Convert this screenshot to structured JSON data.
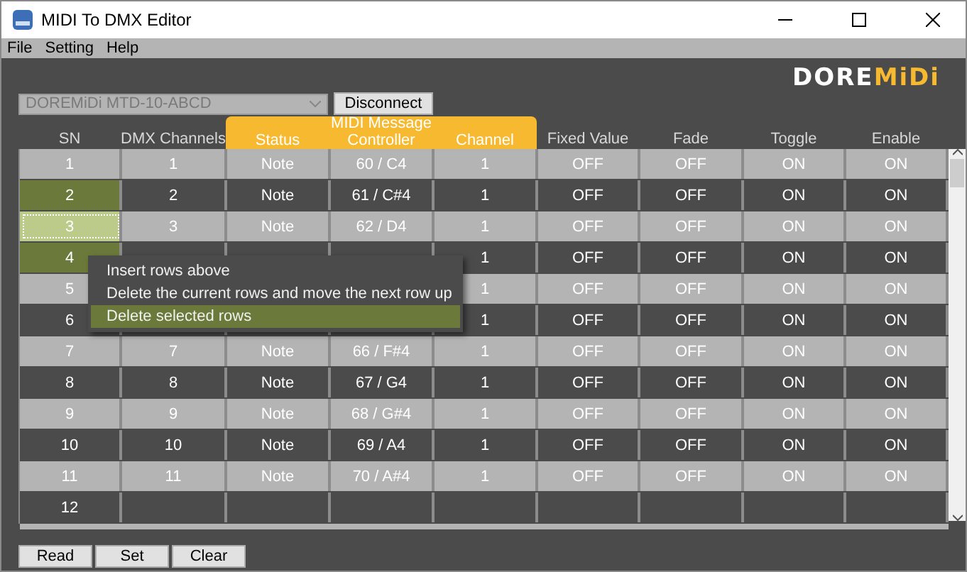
{
  "window": {
    "title": "MIDI To DMX Editor"
  },
  "menu": [
    "File",
    "Setting",
    "Help"
  ],
  "logo": [
    {
      "text": "DORE",
      "color": "#ffffff"
    },
    {
      "text": "MiDi",
      "color": "#f6b92f"
    }
  ],
  "device": {
    "value": "DOREMiDi MTD-10-ABCD",
    "disabled": true
  },
  "connect_button": "Disconnect",
  "table": {
    "column_group": "MIDI Message",
    "columns": [
      {
        "label": "SN",
        "grouped": false
      },
      {
        "label": "DMX Channels",
        "grouped": false
      },
      {
        "label": "Status",
        "grouped": true
      },
      {
        "label": "Controller",
        "grouped": true
      },
      {
        "label": "Channel",
        "grouped": true
      },
      {
        "label": "Fixed Value",
        "grouped": false
      },
      {
        "label": "Fade",
        "grouped": false
      },
      {
        "label": "Toggle",
        "grouped": false
      },
      {
        "label": "Enable",
        "grouped": false
      }
    ],
    "rows": [
      {
        "selected": false,
        "focused": false,
        "cells": [
          "1",
          "1",
          "Note",
          "60 / C4",
          "1",
          "OFF",
          "OFF",
          "ON",
          "ON"
        ]
      },
      {
        "selected": true,
        "focused": false,
        "cells": [
          "2",
          "2",
          "Note",
          "61 / C#4",
          "1",
          "OFF",
          "OFF",
          "ON",
          "ON"
        ]
      },
      {
        "selected": true,
        "focused": true,
        "cells": [
          "3",
          "3",
          "Note",
          "62 / D4",
          "1",
          "OFF",
          "OFF",
          "ON",
          "ON"
        ]
      },
      {
        "selected": true,
        "focused": false,
        "cells": [
          "4",
          null,
          null,
          null,
          "1",
          "OFF",
          "OFF",
          "ON",
          "ON"
        ]
      },
      {
        "selected": false,
        "focused": false,
        "cells": [
          "5",
          null,
          null,
          null,
          "1",
          "OFF",
          "OFF",
          "ON",
          "ON"
        ]
      },
      {
        "selected": false,
        "focused": false,
        "cells": [
          "6",
          null,
          null,
          null,
          "1",
          "OFF",
          "OFF",
          "ON",
          "ON"
        ]
      },
      {
        "selected": false,
        "focused": false,
        "cells": [
          "7",
          "7",
          "Note",
          "66 / F#4",
          "1",
          "OFF",
          "OFF",
          "ON",
          "ON"
        ]
      },
      {
        "selected": false,
        "focused": false,
        "cells": [
          "8",
          "8",
          "Note",
          "67 / G4",
          "1",
          "OFF",
          "OFF",
          "ON",
          "ON"
        ]
      },
      {
        "selected": false,
        "focused": false,
        "cells": [
          "9",
          "9",
          "Note",
          "68 / G#4",
          "1",
          "OFF",
          "OFF",
          "ON",
          "ON"
        ]
      },
      {
        "selected": false,
        "focused": false,
        "cells": [
          "10",
          "10",
          "Note",
          "69 / A4",
          "1",
          "OFF",
          "OFF",
          "ON",
          "ON"
        ]
      },
      {
        "selected": false,
        "focused": false,
        "cells": [
          "11",
          "11",
          "Note",
          "70 / A#4",
          "1",
          "OFF",
          "OFF",
          "ON",
          "ON"
        ]
      },
      {
        "selected": false,
        "focused": false,
        "cells": [
          "12",
          null,
          null,
          null,
          null,
          null,
          null,
          null,
          null
        ]
      }
    ]
  },
  "context_menu": [
    {
      "label": "Insert rows above",
      "selected": false
    },
    {
      "label": "Delete the current rows and move the next row up",
      "selected": false
    },
    {
      "label": "Delete selected rows",
      "selected": true
    }
  ],
  "buttons": [
    "Read",
    "Set",
    "Clear"
  ]
}
